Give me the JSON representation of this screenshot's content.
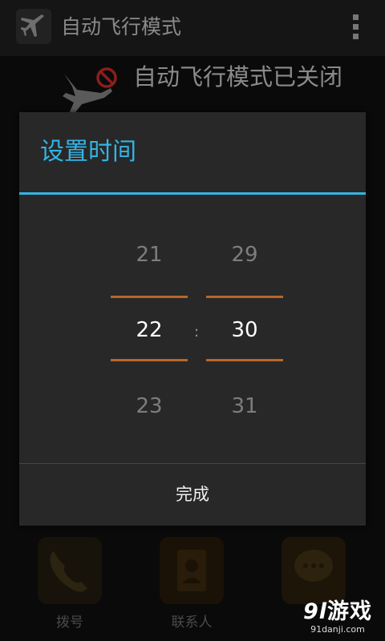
{
  "app": {
    "title": "自动飞行模式",
    "status_text": "自动飞行模式已关闭",
    "app_icon": "airplane-icon",
    "status_icon": "prohibited-icon"
  },
  "dialog": {
    "title": "设置时间",
    "hour": {
      "above": "21",
      "selected": "22",
      "below": "23"
    },
    "separator": ":",
    "minute": {
      "above": "29",
      "selected": "30",
      "below": "31"
    },
    "done_label": "完成"
  },
  "dock": {
    "items": [
      {
        "label": "拨号",
        "icon": "phone-icon"
      },
      {
        "label": "联系人",
        "icon": "contacts-icon"
      },
      {
        "label": "",
        "icon": "messaging-icon"
      }
    ]
  },
  "watermark": {
    "number": "9l",
    "text": "游戏",
    "url": "91danji.com"
  },
  "colors": {
    "accent": "#33b5e5",
    "selection_line": "#b8672a",
    "dialog_bg": "#282828"
  }
}
